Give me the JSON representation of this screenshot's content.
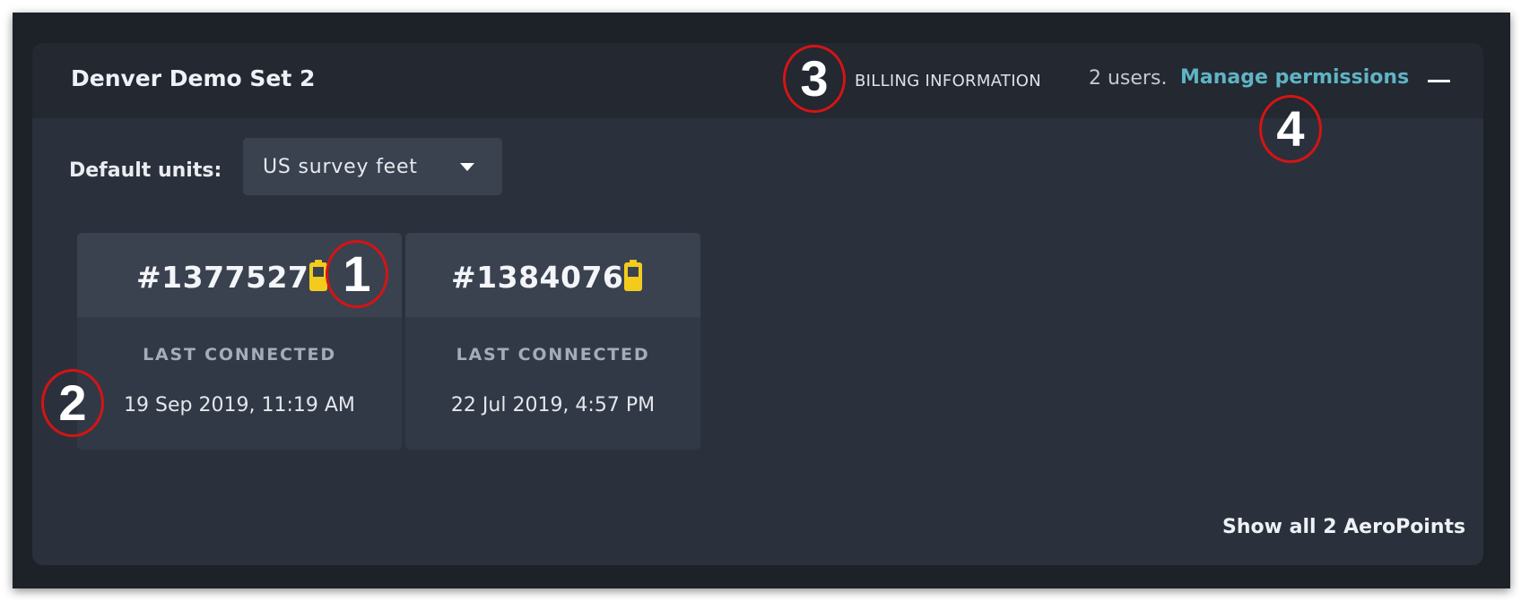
{
  "set": {
    "title": "Denver Demo Set 2",
    "billing_label": "BILLING INFORMATION",
    "users_count": "2 users.",
    "manage_permissions": "Manage permissions",
    "collapse_icon": "minus-icon"
  },
  "units": {
    "label": "Default units:",
    "selected": "US survey feet",
    "dropdown_icon": "caret-down-icon"
  },
  "aeropoints": [
    {
      "id": "#1377527",
      "battery_icon": "battery-icon",
      "battery_color": "#f2cb1d",
      "last_connected_label": "LAST CONNECTED",
      "last_connected": "19 Sep 2019, 11:19 AM"
    },
    {
      "id": "#1384076",
      "battery_icon": "battery-icon",
      "battery_color": "#f2cb1d",
      "last_connected_label": "LAST CONNECTED",
      "last_connected": "22 Jul 2019, 4:57 PM"
    }
  ],
  "show_all": "Show all 2 AeroPoints",
  "callouts": [
    "1",
    "2",
    "3",
    "4"
  ],
  "colors": {
    "accent_link": "#5fb4c4",
    "callout_ring": "#d51414",
    "battery": "#f2cb1d"
  }
}
